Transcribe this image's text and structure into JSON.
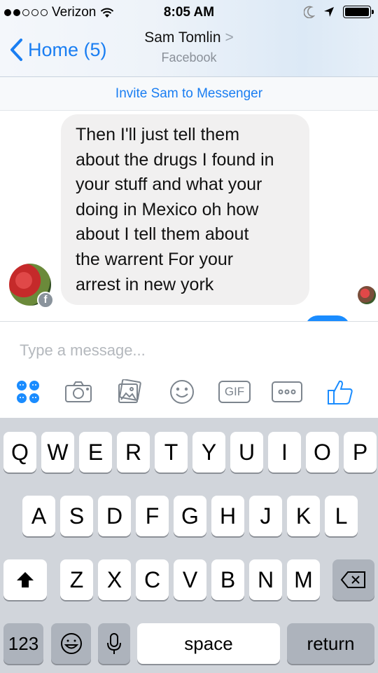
{
  "status_bar": {
    "carrier": "Verizon",
    "time": "8:05 AM",
    "signal_dots": [
      true,
      true,
      false,
      false,
      false
    ]
  },
  "nav": {
    "back_label": "Home (5)",
    "contact_name": "Sam Tomlin",
    "contact_chevron": ">",
    "contact_source": "Facebook"
  },
  "invite_banner": "Invite Sam to Messenger",
  "messages": [
    {
      "direction": "incoming",
      "lines": [
        "Then I'll just tell them",
        "about the drugs I found in",
        "your stuff and what your",
        "doing in Mexico oh how",
        "about I tell them about",
        "the warrent For your",
        "arrest in new york"
      ]
    }
  ],
  "composer": {
    "placeholder": "Type a message...",
    "tools": [
      "stickers-icon",
      "camera-icon",
      "gallery-icon",
      "emoji-icon",
      "gif-icon",
      "more-icon",
      "like-icon"
    ],
    "gif_label": "GIF"
  },
  "keyboard": {
    "row1": [
      "Q",
      "W",
      "E",
      "R",
      "T",
      "Y",
      "U",
      "I",
      "O",
      "P"
    ],
    "row2": [
      "A",
      "S",
      "D",
      "F",
      "G",
      "H",
      "J",
      "K",
      "L"
    ],
    "row3": [
      "Z",
      "X",
      "C",
      "V",
      "B",
      "N",
      "M"
    ],
    "numbers_label": "123",
    "space_label": "space",
    "return_label": "return"
  },
  "colors": {
    "accent": "#1a7ef2",
    "bubble_incoming": "#f1f0f0",
    "keyboard_bg": "#d1d5db"
  }
}
